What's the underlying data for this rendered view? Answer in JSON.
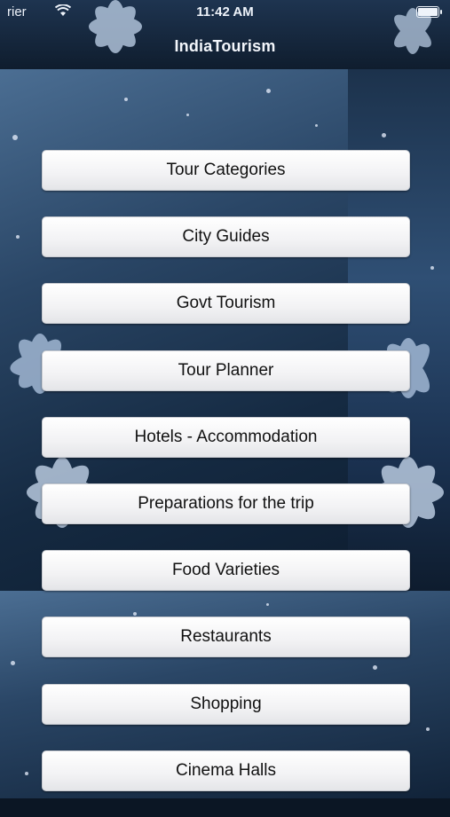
{
  "status_bar": {
    "carrier": "rier",
    "time": "11:42 AM"
  },
  "nav": {
    "title": "IndiaTourism"
  },
  "menu": {
    "items": [
      {
        "label": "Tour Categories"
      },
      {
        "label": "City Guides"
      },
      {
        "label": "Govt Tourism"
      },
      {
        "label": "Tour Planner"
      },
      {
        "label": "Hotels - Accommodation"
      },
      {
        "label": "Preparations for the trip"
      },
      {
        "label": "Food Varieties"
      },
      {
        "label": "Restaurants"
      },
      {
        "label": "Shopping"
      },
      {
        "label": "Cinema Halls"
      }
    ]
  },
  "colors": {
    "background_dark": "#0b1624",
    "background_blue": "#2a4666",
    "button_face": "#f2f2f4",
    "button_text": "#111111"
  }
}
